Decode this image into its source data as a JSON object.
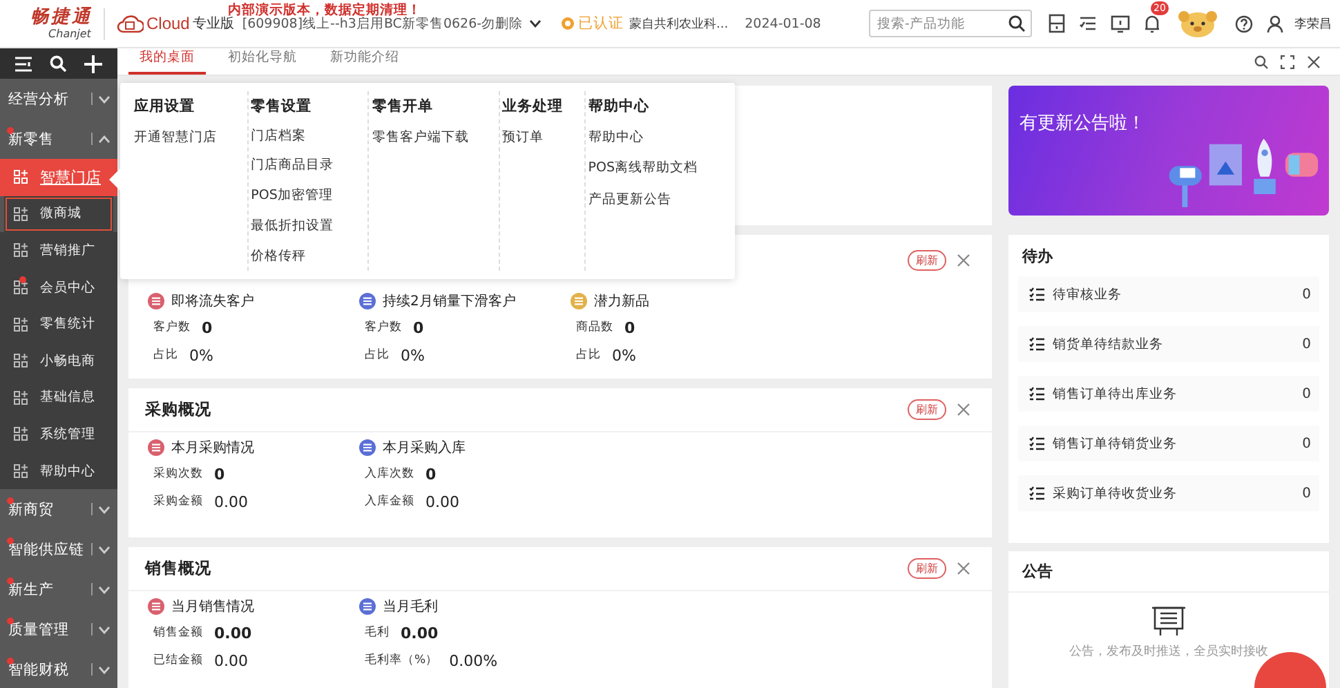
{
  "header": {
    "logo": {
      "name": "畅捷通",
      "sub": "Chanjet"
    },
    "product": "Cloud",
    "edition": "专业版",
    "account": "[609908]线上--h3启用BC新零售0626-勿删除",
    "notice": "内部演示版本，数据定期清理！",
    "verified": "已认证",
    "company": "蒙自共利农业科...",
    "date": "2024-01-08",
    "search": {
      "placeholder": "搜索-产品功能"
    },
    "bell_badge": "20",
    "user": "李荣昌"
  },
  "tabs": [
    {
      "label": "我的桌面",
      "selected": true
    },
    {
      "label": "初始化导航",
      "selected": false
    },
    {
      "label": "新功能介绍",
      "selected": false
    }
  ],
  "sidebar": {
    "sections": [
      {
        "label": "经营分析",
        "expanded": false,
        "dot": false
      },
      {
        "label": "新零售",
        "expanded": true,
        "dot": true,
        "children": [
          {
            "label": "智慧门店",
            "selected": true,
            "focused": false,
            "dot": false
          },
          {
            "label": "微商城",
            "selected": false,
            "focused": true,
            "dot": false
          },
          {
            "label": "营销推广",
            "selected": false,
            "focused": false,
            "dot": false
          },
          {
            "label": "会员中心",
            "selected": false,
            "focused": false,
            "dot": true
          },
          {
            "label": "零售统计",
            "selected": false,
            "focused": false,
            "dot": false
          },
          {
            "label": "小畅电商",
            "selected": false,
            "focused": false,
            "dot": false
          },
          {
            "label": "基础信息",
            "selected": false,
            "focused": false,
            "dot": false
          },
          {
            "label": "系统管理",
            "selected": false,
            "focused": false,
            "dot": false
          },
          {
            "label": "帮助中心",
            "selected": false,
            "focused": false,
            "dot": false
          }
        ]
      },
      {
        "label": "新商贸",
        "expanded": false,
        "dot": true
      },
      {
        "label": "智能供应链",
        "expanded": false,
        "dot": true
      },
      {
        "label": "新生产",
        "expanded": false,
        "dot": true
      },
      {
        "label": "质量管理",
        "expanded": false,
        "dot": true
      },
      {
        "label": "智能财税",
        "expanded": false,
        "dot": true
      }
    ]
  },
  "menu": [
    {
      "title": "应用设置",
      "items": [
        "开通智慧门店"
      ]
    },
    {
      "title": "零售设置",
      "items": [
        "门店档案",
        "门店商品目录",
        "POS加密管理",
        "最低折扣设置",
        "价格传秤"
      ]
    },
    {
      "title": "零售开单",
      "items": [
        "零售客户端下载"
      ]
    },
    {
      "title": "业务处理",
      "items": [
        "预订单"
      ]
    },
    {
      "title": "帮助中心",
      "items": [
        "帮助中心",
        "POS离线帮助文档",
        "产品更新公告"
      ]
    }
  ],
  "cards": [
    {
      "kind": "blank"
    },
    {
      "refresh": "刷新",
      "groups": [
        {
          "title": "即将流失客户",
          "color": "#d9606e",
          "rows": [
            {
              "label": "客户数",
              "value": "0",
              "bold": true
            },
            {
              "label": "占比",
              "value": "0%",
              "bold": false
            }
          ]
        },
        {
          "title": "持续2月销量下滑客户",
          "color": "#5b6fd6",
          "rows": [
            {
              "label": "客户数",
              "value": "0",
              "bold": true
            },
            {
              "label": "占比",
              "value": "0%",
              "bold": false
            }
          ]
        },
        {
          "title": "潜力新品",
          "color": "#e2b24a",
          "rows": [
            {
              "label": "商品数",
              "value": "0",
              "bold": true
            },
            {
              "label": "占比",
              "value": "0%",
              "bold": false
            }
          ]
        }
      ]
    },
    {
      "title": "采购概况",
      "refresh": "刷新",
      "groups": [
        {
          "title": "本月采购情况",
          "color": "#d9606e",
          "rows": [
            {
              "label": "采购次数",
              "value": "0",
              "bold": true
            },
            {
              "label": "采购金额",
              "value": "0.00",
              "bold": false
            }
          ]
        },
        {
          "title": "本月采购入库",
          "color": "#5b6fd6",
          "rows": [
            {
              "label": "入库次数",
              "value": "0",
              "bold": true
            },
            {
              "label": "入库金额",
              "value": "0.00",
              "bold": false
            }
          ]
        }
      ]
    },
    {
      "title": "销售概况",
      "refresh": "刷新",
      "groups": [
        {
          "title": "当月销售情况",
          "color": "#d9606e",
          "rows": [
            {
              "label": "销售金额",
              "value": "0.00",
              "bold": true
            },
            {
              "label": "已结金额",
              "value": "0.00",
              "bold": false
            }
          ]
        },
        {
          "title": "当月毛利",
          "color": "#5b6fd6",
          "rows": [
            {
              "label": "毛利",
              "value": "0.00",
              "bold": true
            },
            {
              "label": "毛利率（%）",
              "value": "0.00%",
              "bold": false
            }
          ]
        }
      ]
    }
  ],
  "banner": {
    "text": "有更新公告啦！"
  },
  "todo": {
    "title": "待办",
    "items": [
      {
        "label": "待审核业务",
        "count": "0"
      },
      {
        "label": "销货单待结款业务",
        "count": "0"
      },
      {
        "label": "销售订单待出库业务",
        "count": "0"
      },
      {
        "label": "销售订单待销货业务",
        "count": "0"
      },
      {
        "label": "采购订单待收货业务",
        "count": "0"
      }
    ]
  },
  "notice_board": {
    "title": "公告",
    "empty_text": "公告，发布及时推送，全员实时接收"
  }
}
